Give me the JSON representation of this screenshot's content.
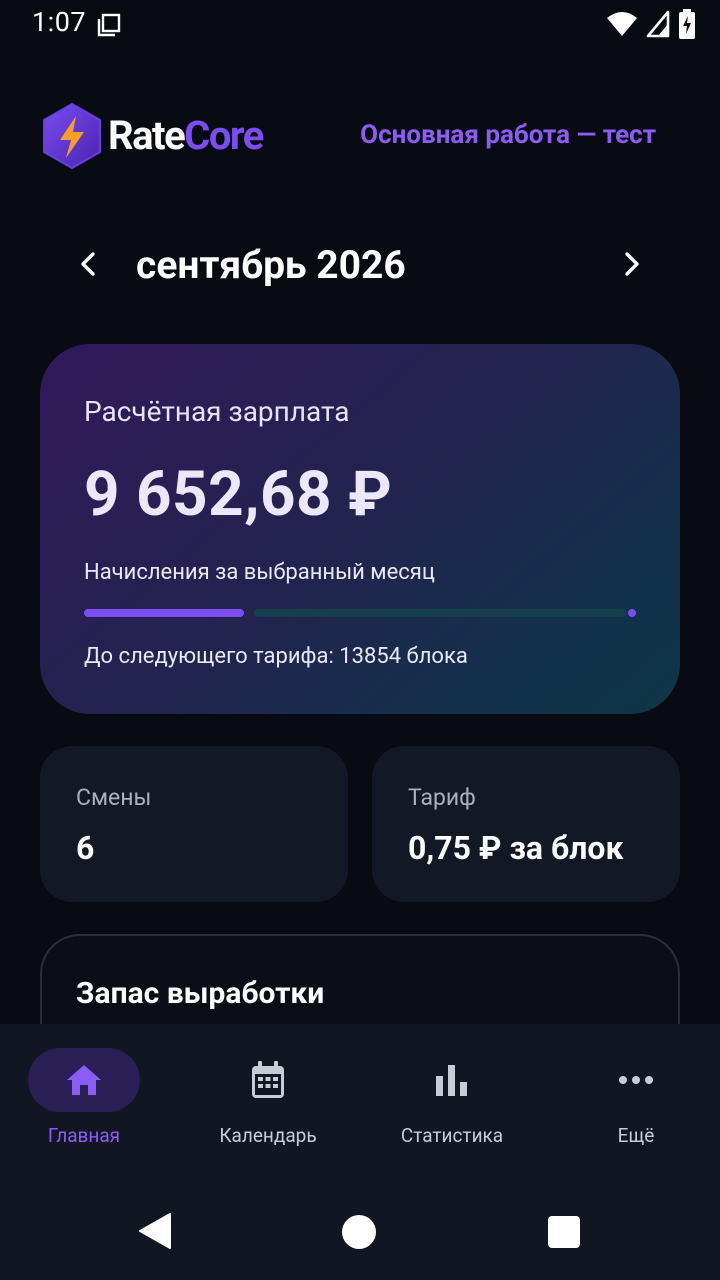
{
  "status_bar": {
    "time": "1:07"
  },
  "header": {
    "brand_part1": "Rate",
    "brand_part2": "Core",
    "profile_link": "Основная работа — тест"
  },
  "month_selector": {
    "title": "сентябрь 2026"
  },
  "salary_card": {
    "label": "Расчётная зарплата",
    "amount": "9 652,68 ₽",
    "subtitle": "Начисления за выбранный месяц",
    "progress_fraction": 0.29,
    "next_tariff_text": "До следующего тарифа: 13854 блока"
  },
  "stats": {
    "shifts": {
      "label": "Смены",
      "value": "6"
    },
    "tariff": {
      "label": "Тариф",
      "value": "0,75 ₽ за блок"
    }
  },
  "reserve_card": {
    "title": "Запас выработки"
  },
  "bottom_nav": {
    "items": [
      {
        "label": "Главная",
        "icon": "home-icon",
        "active": true
      },
      {
        "label": "Календарь",
        "icon": "calendar-icon",
        "active": false
      },
      {
        "label": "Статистика",
        "icon": "bar-chart-icon",
        "active": false
      },
      {
        "label": "Ещё",
        "icon": "more-dots-icon",
        "active": false
      }
    ]
  },
  "colors": {
    "background": "#090b13",
    "accent": "#7b4df3",
    "accent_text": "#8b5cf6",
    "card": "#121826",
    "nav_background": "#121622"
  }
}
